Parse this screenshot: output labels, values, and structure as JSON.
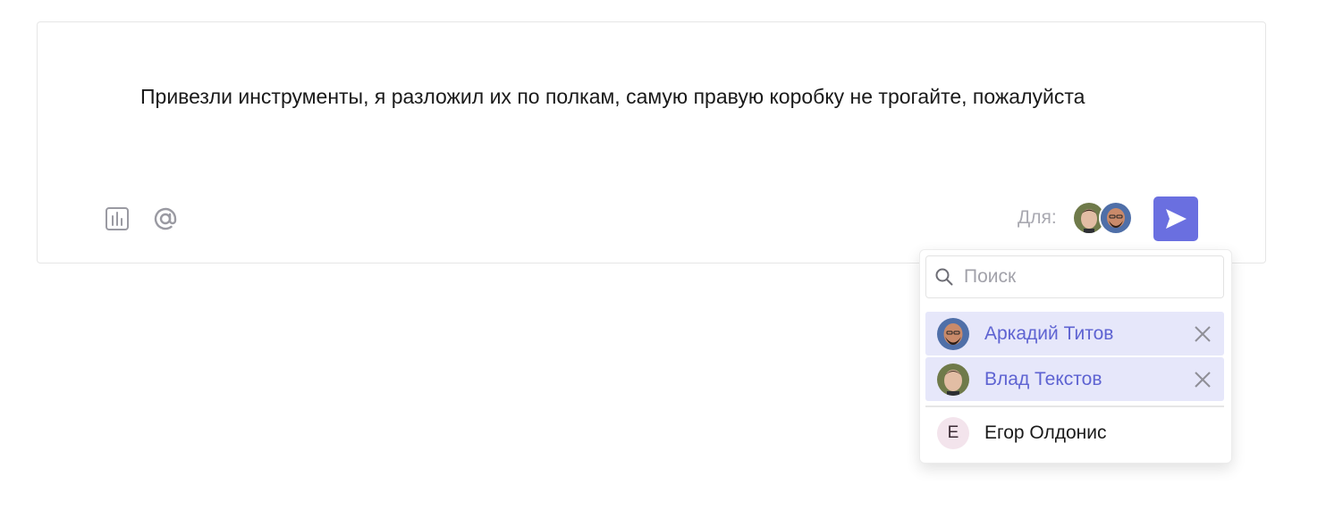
{
  "composer": {
    "message": "Привезли инструменты, я разложил их по полкам, самую правую коробку не трогайте, пожалуйста",
    "recipients_label": "Для:",
    "tools": [
      {
        "icon": "poll-chart-icon"
      },
      {
        "icon": "at-mention-icon"
      }
    ],
    "send_icon": "send-arrow-icon",
    "accent_color": "#6a6fe0"
  },
  "recipient_picker": {
    "search_placeholder": "Поиск",
    "search_value": "",
    "selected": [
      {
        "name": "Аркадий Титов"
      },
      {
        "name": "Влад Текстов"
      }
    ],
    "others": [
      {
        "initial": "Е",
        "name": "Егор Олдонис"
      }
    ],
    "selected_bg": "#e6e7fa",
    "selected_text_color": "#5e63d2"
  }
}
